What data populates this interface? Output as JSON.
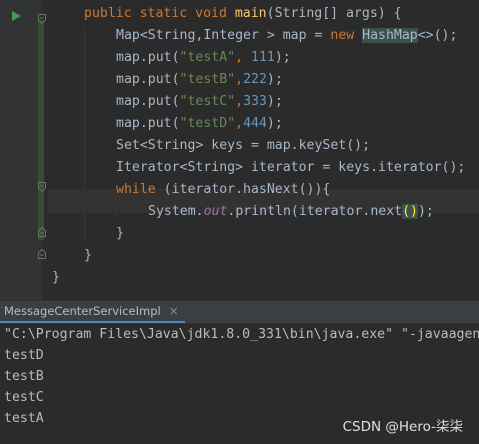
{
  "editor": {
    "lines": [
      {
        "parts": [
          {
            "t": "public static void ",
            "c": "kw"
          },
          {
            "t": "main",
            "c": "fn"
          },
          {
            "t": "(String[] args) {",
            "c": ""
          }
        ]
      },
      {
        "parts": [
          {
            "t": "Map<String,Integer > map = ",
            "c": ""
          },
          {
            "t": "new ",
            "c": "kw"
          },
          {
            "t": "HashMap",
            "c": "hl"
          },
          {
            "t": "<>();",
            "c": ""
          }
        ]
      },
      {
        "parts": [
          {
            "t": "map.put(",
            "c": ""
          },
          {
            "t": "\"testA\"",
            "c": "str"
          },
          {
            "t": ", ",
            "c": "kw"
          },
          {
            "t": "111",
            "c": "num"
          },
          {
            "t": ");",
            "c": ""
          }
        ]
      },
      {
        "parts": [
          {
            "t": "map.put(",
            "c": ""
          },
          {
            "t": "\"testB\"",
            "c": "str"
          },
          {
            "t": ",",
            "c": "kw"
          },
          {
            "t": "222",
            "c": "num"
          },
          {
            "t": ");",
            "c": ""
          }
        ]
      },
      {
        "parts": [
          {
            "t": "map.put(",
            "c": ""
          },
          {
            "t": "\"testC\"",
            "c": "str"
          },
          {
            "t": ",",
            "c": "kw"
          },
          {
            "t": "333",
            "c": "num"
          },
          {
            "t": ");",
            "c": ""
          }
        ]
      },
      {
        "parts": [
          {
            "t": "map.put(",
            "c": ""
          },
          {
            "t": "\"testD\"",
            "c": "str"
          },
          {
            "t": ",",
            "c": "kw"
          },
          {
            "t": "444",
            "c": "num"
          },
          {
            "t": ");",
            "c": ""
          }
        ]
      },
      {
        "parts": [
          {
            "t": "Set<String> keys = map.keySet();",
            "c": ""
          }
        ]
      },
      {
        "parts": [
          {
            "t": "Iterator<String> iterator = keys.iterator();",
            "c": ""
          }
        ]
      },
      {
        "parts": [
          {
            "t": "while ",
            "c": "kw"
          },
          {
            "t": "(iterator.hasNext()){",
            "c": ""
          }
        ]
      },
      {
        "parts": [
          {
            "t": "System.",
            "c": ""
          },
          {
            "t": "out",
            "c": "fld"
          },
          {
            "t": ".println(iterator.next",
            "c": ""
          },
          {
            "t": "()",
            "c": "brace-hl"
          },
          {
            "t": ");",
            "c": ""
          }
        ]
      },
      {
        "parts": [
          {
            "t": "}",
            "c": ""
          }
        ]
      },
      {
        "parts": [
          {
            "t": "}",
            "c": ""
          }
        ]
      },
      {
        "parts": [
          {
            "t": "}",
            "c": ""
          }
        ]
      }
    ]
  },
  "run_panel": {
    "tab_label": "MessageCenterServiceImpl",
    "close_glyph": "×"
  },
  "console": {
    "lines": [
      "\"C:\\Program Files\\Java\\jdk1.8.0_331\\bin\\java.exe\" \"-javaagen",
      "testD",
      "testB",
      "testC",
      "testA"
    ]
  },
  "watermark": "CSDN @Hero-柒柒",
  "icons": {
    "run": "run-arrow-icon",
    "fold": "fold-marker-icon",
    "close": "close-icon"
  },
  "colors": {
    "editor_bg": "#2b2b2b",
    "keyword": "#cc7832",
    "string": "#6a8759",
    "number": "#6897bb",
    "method": "#ffc66d",
    "static_field": "#9876aa",
    "run_green": "#499c54"
  }
}
